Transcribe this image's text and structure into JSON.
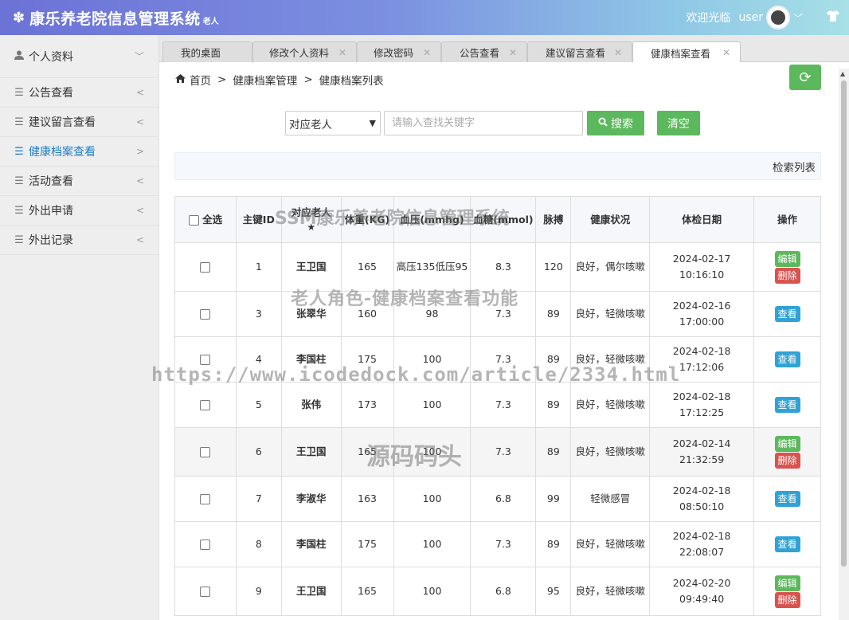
{
  "header": {
    "title": "康乐养老院信息管理系统",
    "role": "老人",
    "welcome": "欢迎光临",
    "username": "user",
    "icons": {
      "logo": "gear-icon",
      "theme": "tshirt-icon"
    }
  },
  "sidebar": {
    "items": [
      {
        "label": "个人资料",
        "icon": "user-icon",
        "arrow": "﹀"
      },
      {
        "label": "公告查看",
        "icon": "list-icon",
        "arrow": "<"
      },
      {
        "label": "建议留言查看",
        "icon": "list-icon",
        "arrow": "<"
      },
      {
        "label": "健康档案查看",
        "icon": "list-icon",
        "arrow": ">"
      },
      {
        "label": "活动查看",
        "icon": "list-icon",
        "arrow": "<"
      },
      {
        "label": "外出申请",
        "icon": "list-icon",
        "arrow": "<"
      },
      {
        "label": "外出记录",
        "icon": "list-icon",
        "arrow": "<"
      }
    ]
  },
  "tabs": [
    {
      "label": "我的桌面"
    },
    {
      "label": "修改个人资料"
    },
    {
      "label": "修改密码"
    },
    {
      "label": "公告查看"
    },
    {
      "label": "建议留言查看"
    },
    {
      "label": "健康档案查看"
    }
  ],
  "breadcrumb": {
    "home": "首页",
    "level1": "健康档案管理",
    "level2": "健康档案列表"
  },
  "search": {
    "select_value": "对应老人",
    "placeholder": "请输入查找关键字",
    "search_label": "搜索",
    "clear_label": "清空"
  },
  "list_title": "检索列表",
  "table": {
    "headers": {
      "select_all": "全选",
      "id": "主键ID",
      "elder": "对应老人",
      "weight": "体重(KG)",
      "bp": "血压(mmhg)",
      "sugar": "血糖(mmol)",
      "pulse": "脉搏",
      "status": "健康状况",
      "date": "体检日期",
      "ops": "操作"
    },
    "rows": [
      {
        "id": "1",
        "elder": "王卫国",
        "weight": "165",
        "bp": "高压135低压95",
        "sugar": "8.3",
        "pulse": "120",
        "status": "良好，偶尔咳嗽",
        "date": "2024-02-17 10:16:10"
      },
      {
        "id": "3",
        "elder": "张翠华",
        "weight": "160",
        "bp": "98",
        "sugar": "7.3",
        "pulse": "89",
        "status": "良好，轻微咳嗽",
        "date": "2024-02-16 17:00:00"
      },
      {
        "id": "4",
        "elder": "李国柱",
        "weight": "175",
        "bp": "100",
        "sugar": "7.3",
        "pulse": "89",
        "status": "良好，轻微咳嗽",
        "date": "2024-02-18 17:12:06"
      },
      {
        "id": "5",
        "elder": "张伟",
        "weight": "173",
        "bp": "100",
        "sugar": "7.3",
        "pulse": "89",
        "status": "良好，轻微咳嗽",
        "date": "2024-02-18 17:12:25"
      },
      {
        "id": "6",
        "elder": "王卫国",
        "weight": "165",
        "bp": "100",
        "sugar": "7.3",
        "pulse": "89",
        "status": "良好，轻微咳嗽",
        "date": "2024-02-14 21:32:59"
      },
      {
        "id": "7",
        "elder": "李淑华",
        "weight": "163",
        "bp": "100",
        "sugar": "6.8",
        "pulse": "99",
        "status": "轻微感冒",
        "date": "2024-02-18 08:50:10"
      },
      {
        "id": "8",
        "elder": "李国柱",
        "weight": "175",
        "bp": "100",
        "sugar": "7.3",
        "pulse": "89",
        "status": "良好，轻微咳嗽",
        "date": "2024-02-18 22:08:07"
      },
      {
        "id": "9",
        "elder": "王卫国",
        "weight": "165",
        "bp": "100",
        "sugar": "6.8",
        "pulse": "95",
        "status": "良好，轻微咳嗽",
        "date": "2024-02-20 09:49:40"
      }
    ],
    "actions": {
      "edit": "编辑",
      "delete": "删除",
      "view": "查看"
    }
  },
  "watermarks": {
    "line1": "SSM康乐养老院信息管理系统",
    "line2": "老人角色-健康档案查看功能",
    "url": "https://www.icodedock.com/article/2334.html",
    "brand": "源码码头"
  },
  "colors": {
    "accent": "#5cb85c",
    "danger": "#d9534f",
    "info": "#2fa2d6",
    "elder_name": "#b4232a",
    "sidebar_active": "#1e7ec8"
  }
}
